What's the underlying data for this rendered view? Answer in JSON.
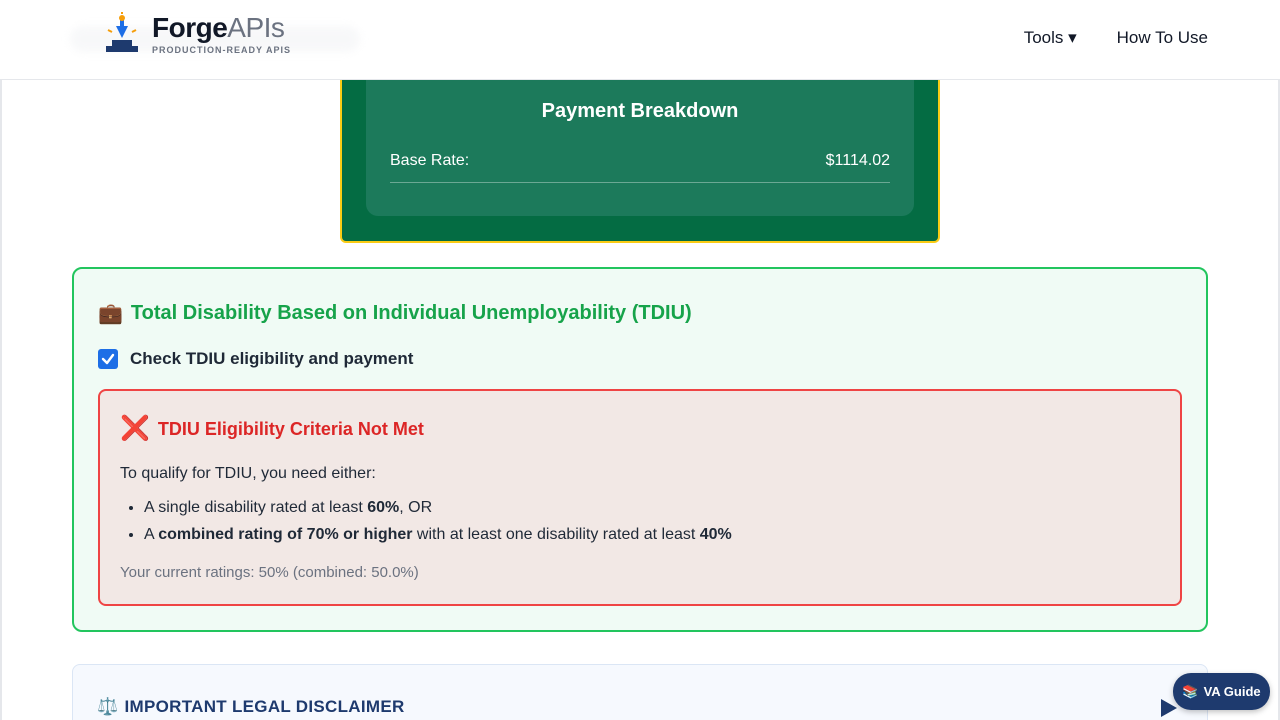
{
  "header": {
    "brand_name_bold": "Forge",
    "brand_name_light": "APIs",
    "brand_tagline": "PRODUCTION-READY APIS",
    "nav": [
      {
        "label": "Tools ▾"
      },
      {
        "label": "How To Use"
      }
    ]
  },
  "payment": {
    "title": "Payment Breakdown",
    "base_rate_label": "Base Rate:",
    "base_rate_value": "$1114.02"
  },
  "tdiu": {
    "icon": "💼",
    "title": "Total Disability Based on Individual Unemployability (TDIU)",
    "checkbox_label": "Check TDIU eligibility and payment",
    "checkbox_checked": true,
    "result": {
      "icon": "❌",
      "title": "TDIU Eligibility Criteria Not Met",
      "intro": "To qualify for TDIU, you need either:",
      "req1_pre": "A single disability rated at least ",
      "req1_bold": "60%",
      "req1_post": ", OR",
      "req2_pre": "A ",
      "req2_bold": "combined rating of 70% or higher",
      "req2_mid": " with at least one disability rated at least ",
      "req2_bold2": "40%",
      "current": "Your current ratings: 50% (combined: 50.0%)"
    }
  },
  "disclaimer": {
    "icon": "⚖️",
    "title": "IMPORTANT LEGAL DISCLAIMER"
  },
  "va_guide": {
    "icon": "📚",
    "label": "VA Guide"
  },
  "colors": {
    "payment_bg": "#046c43",
    "payment_border": "#facc15",
    "tdiu_border": "#22c55e",
    "tdiu_title": "#16a34a",
    "error_border": "#ef4444",
    "error_title": "#dc2626",
    "navy": "#1e3a6e",
    "checkbox": "#1d6ee6"
  }
}
